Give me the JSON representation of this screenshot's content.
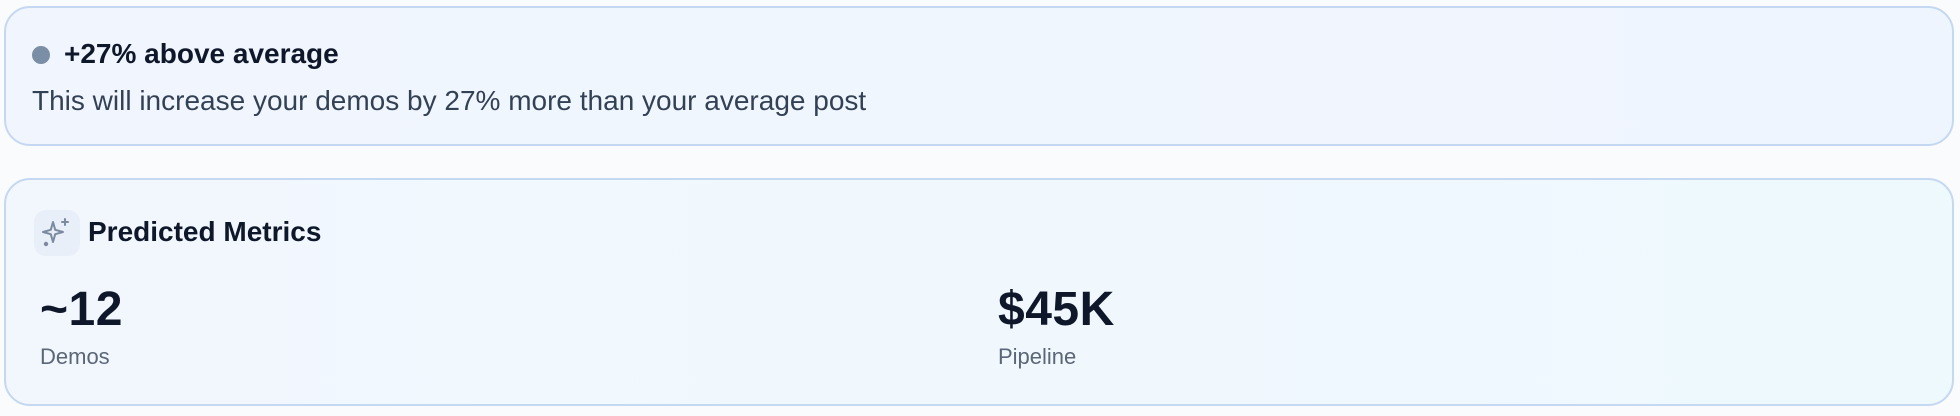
{
  "insight": {
    "title": "+27% above average",
    "description": "This will increase your demos by 27% more than your average post",
    "dot_color": "#7a8ea5"
  },
  "metrics": {
    "title": "Predicted Metrics",
    "icon": "sparkle-icon",
    "items": [
      {
        "value": "~12",
        "label": "Demos"
      },
      {
        "value": "$45K",
        "label": "Pipeline"
      }
    ]
  },
  "colors": {
    "card_border": "#c5d8f2",
    "text_primary": "#0f172a",
    "text_secondary": "#5b6676"
  }
}
